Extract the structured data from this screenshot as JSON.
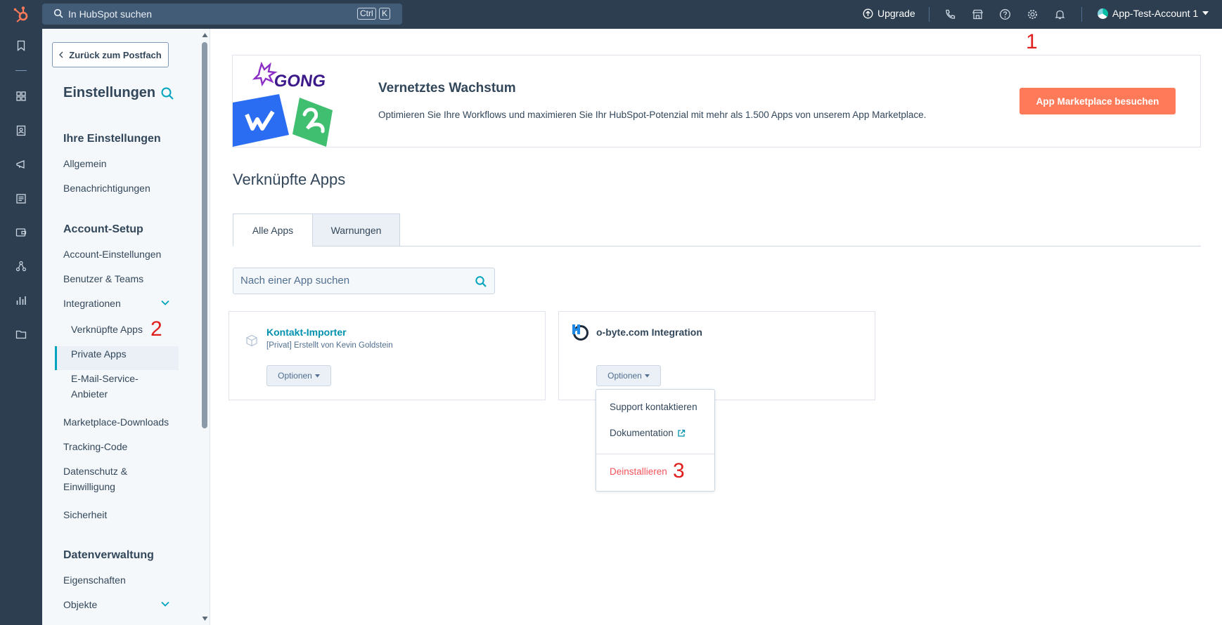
{
  "topbar": {
    "search_placeholder": "In HubSpot suchen",
    "kbd_ctrl": "Ctrl",
    "kbd_k": "K",
    "upgrade_label": "Upgrade",
    "account_name": "App-Test-Account 1",
    "icons": [
      "phone-icon",
      "marketplace-icon",
      "help-icon",
      "settings-icon",
      "notifications-icon"
    ]
  },
  "rail": {
    "icons": [
      "bookmark-icon",
      "dashboard-icon",
      "contacts-icon",
      "marketing-icon",
      "content-icon",
      "commerce-icon",
      "automation-icon",
      "reports-icon",
      "library-icon"
    ]
  },
  "sidebar": {
    "back_label": "Zurück zum Postfach",
    "title": "Einstellungen",
    "sections": {
      "personal": {
        "heading": "Ihre Einstellungen",
        "items": [
          "Allgemein",
          "Benachrichtigungen"
        ]
      },
      "account": {
        "heading": "Account-Setup",
        "items": [
          "Account-Einstellungen",
          "Benutzer & Teams",
          "Integrationen"
        ],
        "integrations_sub": [
          "Verknüpfte Apps",
          "Private Apps",
          "E-Mail-Service-",
          "Anbieter"
        ],
        "more": [
          "Marketplace-Downloads",
          "Tracking-Code",
          "Datenschutz &",
          "Einwilligung",
          "Sicherheit"
        ]
      },
      "data": {
        "heading": "Datenverwaltung",
        "items": [
          "Eigenschaften",
          "Objekte"
        ]
      }
    }
  },
  "banner": {
    "logo_text": "GONG",
    "title": "Vernetztes Wachstum",
    "text": "Optimieren Sie Ihre Workflows und maximieren Sie Ihr HubSpot-Potenzial mit mehr als 1.500 Apps von unserem App Marketplace.",
    "button": "App Marketplace besuchen"
  },
  "main": {
    "title": "Verknüpfte Apps",
    "tabs": [
      "Alle Apps",
      "Warnungen"
    ],
    "search_placeholder": "Nach einer App suchen",
    "apps": [
      {
        "name": "Kontakt-Importer",
        "subtitle": "[Privat] Erstellt von Kevin Goldstein",
        "options": "Optionen"
      },
      {
        "name": "o-byte.com Integration",
        "options": "Optionen"
      }
    ],
    "dropdown": [
      "Support kontaktieren",
      "Dokumentation",
      "Deinstallieren"
    ]
  },
  "annotations": [
    "1",
    "2",
    "3"
  ],
  "colors": {
    "nav": "#2d3e50",
    "accent_cta": "#ff7a59",
    "link": "#0091ae",
    "danger": "#f2545b",
    "annotation": "#e01e1e"
  }
}
